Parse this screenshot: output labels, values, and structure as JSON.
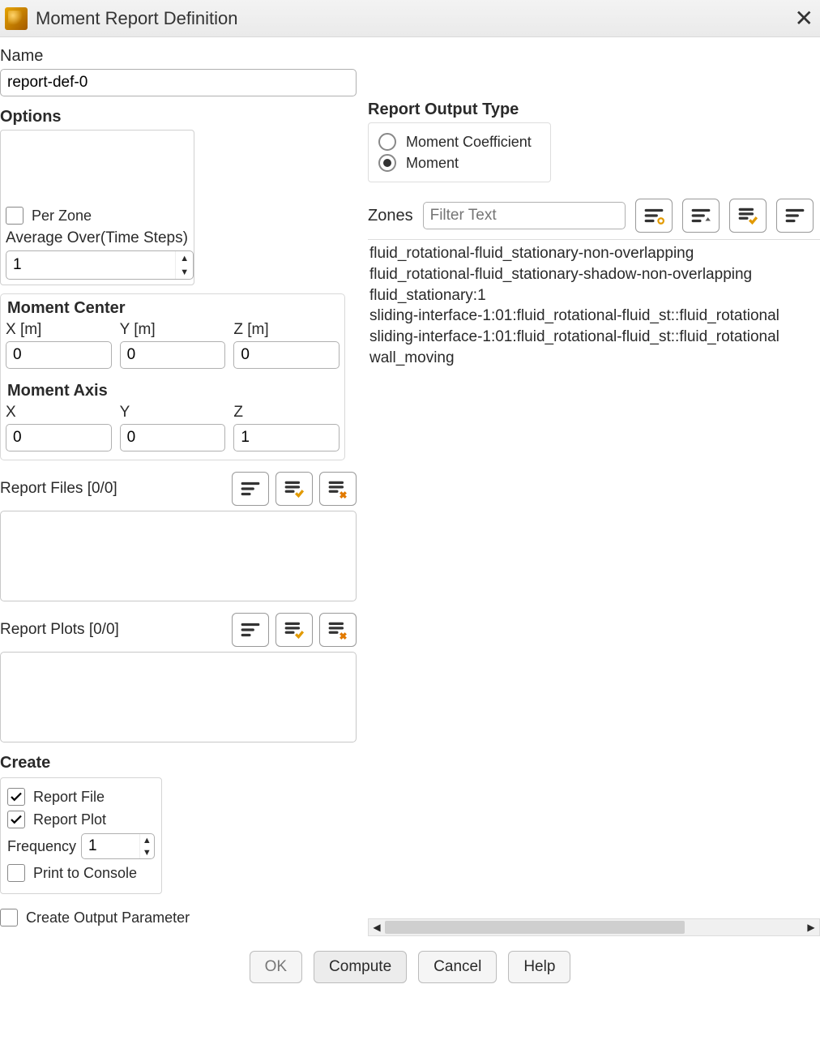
{
  "window": {
    "title": "Moment Report Definition"
  },
  "name": {
    "label": "Name",
    "value": "report-def-0"
  },
  "options": {
    "heading": "Options",
    "per_zone": {
      "label": "Per Zone",
      "checked": false
    },
    "avg_over": {
      "label": "Average Over(Time Steps)",
      "value": "1"
    }
  },
  "moment_center": {
    "heading": "Moment Center",
    "x_label": "X [m]",
    "y_label": "Y [m]",
    "z_label": "Z [m]",
    "x": "0",
    "y": "0",
    "z": "0"
  },
  "moment_axis": {
    "heading": "Moment Axis",
    "x_label": "X",
    "y_label": "Y",
    "z_label": "Z",
    "x": "0",
    "y": "0",
    "z": "1"
  },
  "report_files": {
    "heading": "Report Files  [0/0]"
  },
  "report_plots": {
    "heading": "Report Plots  [0/0]"
  },
  "create": {
    "heading": "Create",
    "report_file": {
      "label": "Report File",
      "checked": true
    },
    "report_plot": {
      "label": "Report Plot",
      "checked": true
    },
    "frequency": {
      "label": "Frequency",
      "value": "1"
    },
    "print_console": {
      "label": "Print to Console",
      "checked": false
    }
  },
  "create_output_param": {
    "label": "Create Output Parameter",
    "checked": false
  },
  "output_type": {
    "heading": "Report Output Type",
    "options": [
      {
        "label": "Moment Coefficient",
        "selected": false
      },
      {
        "label": "Moment",
        "selected": true
      }
    ]
  },
  "zones": {
    "label": "Zones",
    "filter_placeholder": "Filter Text",
    "items": [
      "fluid_rotational-fluid_stationary-non-overlapping",
      "fluid_rotational-fluid_stationary-shadow-non-overlapping",
      "fluid_stationary:1",
      "sliding-interface-1:01:fluid_rotational-fluid_st::fluid_rotational",
      "sliding-interface-1:01:fluid_rotational-fluid_st::fluid_rotational",
      "wall_moving"
    ]
  },
  "buttons": {
    "ok": "OK",
    "compute": "Compute",
    "cancel": "Cancel",
    "help": "Help"
  }
}
